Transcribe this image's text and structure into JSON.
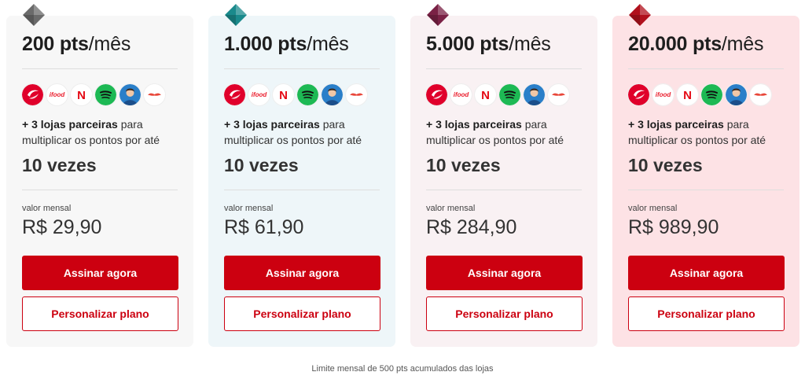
{
  "plans": [
    {
      "points": "200 pts",
      "period": "/mês",
      "partners_bold": "+ 3 lojas parceiras",
      "partners_text": " para multiplicar os pontos por até",
      "multiplier": "10 vezes",
      "monthly_label": "valor mensal",
      "monthly_value": "R$ 29,90",
      "subscribe_label": "Assinar agora",
      "customize_label": "Personalizar plano",
      "background": "#f7f7f7",
      "gem_color": "#6b6b6b"
    },
    {
      "points": "1.000 pts",
      "period": "/mês",
      "partners_bold": "+ 3 lojas parceiras",
      "partners_text": " para multiplicar os pontos por até",
      "multiplier": "10 vezes",
      "monthly_label": "valor mensal",
      "monthly_value": "R$ 61,90",
      "subscribe_label": "Assinar agora",
      "customize_label": "Personalizar plano",
      "background": "#eef6f9",
      "gem_color": "#1a8a8c"
    },
    {
      "points": "5.000 pts",
      "period": "/mês",
      "partners_bold": "+ 3 lojas parceiras",
      "partners_text": " para multiplicar os pontos por até",
      "multiplier": "10 vezes",
      "monthly_label": "valor mensal",
      "monthly_value": "R$ 284,90",
      "subscribe_label": "Assinar agora",
      "customize_label": "Personalizar plano",
      "background": "#f9f1f3",
      "gem_color": "#7a2145"
    },
    {
      "points": "20.000 pts",
      "period": "/mês",
      "partners_bold": "+ 3 lojas parceiras",
      "partners_text": " para multiplicar os pontos por até",
      "multiplier": "10 vezes",
      "monthly_label": "valor mensal",
      "monthly_value": "R$ 989,90",
      "subscribe_label": "Assinar agora",
      "customize_label": "Personalizar plano",
      "background": "#fde2e5",
      "gem_color": "#b0101c"
    }
  ],
  "partner_logos": [
    {
      "name": "livelo-logo",
      "color": "#e0002b"
    },
    {
      "name": "ifood-logo",
      "color": "#ea1d2c",
      "text": "ifood"
    },
    {
      "name": "netflix-logo",
      "color": "#e50914",
      "text": "N"
    },
    {
      "name": "spotify-logo",
      "color": "#1db954"
    },
    {
      "name": "avatar-logo",
      "color": "#2a7fc9"
    },
    {
      "name": "mustache-logo",
      "color": "#e8473a"
    }
  ],
  "footnote": "Limite mensal de 500 pts acumulados das lojas",
  "colors": {
    "accent": "#cc0010",
    "text": "#1e1e1e"
  }
}
